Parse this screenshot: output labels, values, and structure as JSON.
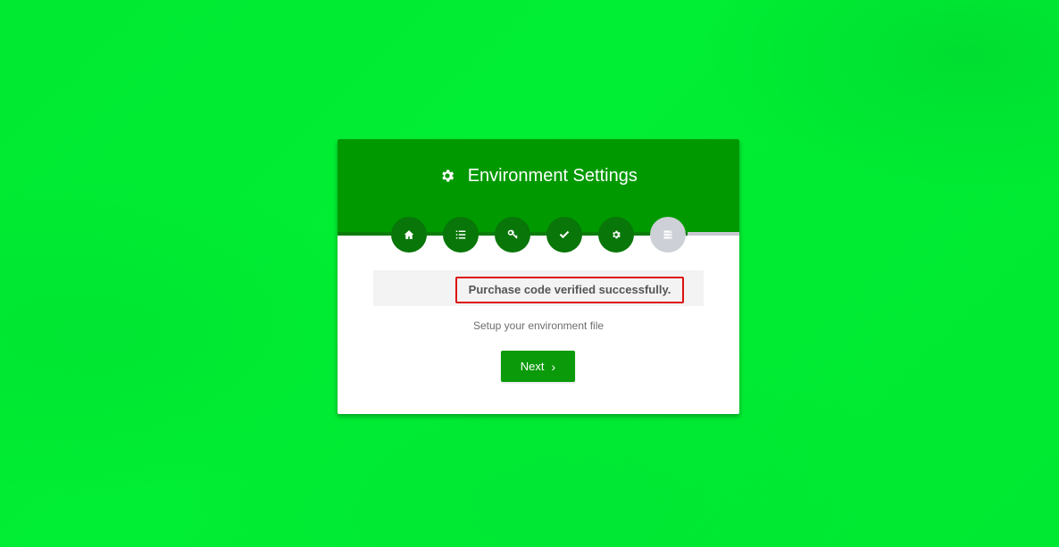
{
  "header": {
    "title": "Environment Settings",
    "icon": "gear-icon",
    "color": "#009a00"
  },
  "steps": [
    {
      "icon": "home-icon",
      "state": "complete"
    },
    {
      "icon": "list-icon",
      "state": "complete"
    },
    {
      "icon": "key-icon",
      "state": "complete"
    },
    {
      "icon": "check-icon",
      "state": "complete"
    },
    {
      "icon": "gear-icon",
      "state": "complete"
    },
    {
      "icon": "server-icon",
      "state": "inactive"
    }
  ],
  "progress": 0.87,
  "alert": {
    "message": "Purchase code verified successfully.",
    "highlight_color": "#dd1111"
  },
  "subtitle": "Setup your environment file",
  "next_button": {
    "label": "Next",
    "icon": "chevron-right-icon"
  },
  "colors": {
    "page_background": "#00ee33",
    "step_active": "#087608",
    "step_inactive": "#cdd0d6",
    "button": "#0a9a0a"
  }
}
